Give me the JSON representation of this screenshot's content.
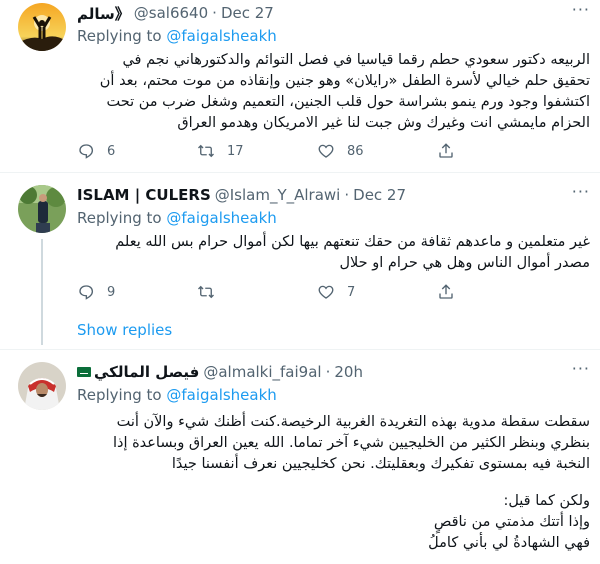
{
  "colors": {
    "accent": "#1d9bf0",
    "secondary": "#536471",
    "text": "#0f1419"
  },
  "tweets": [
    {
      "name": "سالم》",
      "handle": "@sal6640",
      "dot": "·",
      "date": "Dec 27",
      "more": "···",
      "replying_prefix": "Replying to ",
      "replying_to": "@faigalsheakh",
      "body": "الربيعه دكتور سعودي حطم رقما قياسيا في فصل التوائم والدكتورهاني نجم في\nتحقيق حلم خيالي لأسرة الطفل «رايلان» وهو جنين وإنقاذه من موت محتم، بعد أن\nاكتشفوا وجود ورم ينمو بشراسة حول قلب الجنين، التعميم وشغل ضرب من تحت\nالحزام مايمشي انت وغيرك وش جبت لنا غير الامريكان وهدمو العراق",
      "actions": {
        "reply": "6",
        "retweet": "17",
        "like": "86"
      }
    },
    {
      "name": "ISLAM | CULERS",
      "handle": "@Islam_Y_Alrawi",
      "dot": "·",
      "date": "Dec 27",
      "more": "···",
      "replying_prefix": "Replying to ",
      "replying_to": "@faigalsheakh",
      "body": "غير متعلمين و ماعدهم ثقافة من حقك تنعتهم بيها لكن أموال حرام بس الله يعلم\nمصدر أموال الناس وهل هي حرام او حلال",
      "actions": {
        "reply": "9",
        "retweet": "",
        "like": "7"
      },
      "show_replies": "Show replies"
    },
    {
      "name": "فيصل المالكي",
      "handle": "@almalki_fai9al",
      "dot": "·",
      "date": "20h",
      "more": "···",
      "replying_prefix": "Replying to ",
      "replying_to": "@faigalsheakh",
      "body": "سقطت سقطة مدوية بهذه التغريدة الغربية الرخيصة.كنت أظنك شيء والآن أنت\nبنظري وبنظر الكثير من الخليجيين شيء آخر تماما. الله يعين العراق وبساعدة إذا\nالنخبة فيه بمستوى تفكيرك وبعقليتك. نحن كخليجيين نعرف أنفسنا جيدًا",
      "body2": "ولكن كما قيل:\nوإذا أتتك مذمتي من ناقصٍ\nفهي الشهادةُ لي بأني كاملُ"
    }
  ]
}
